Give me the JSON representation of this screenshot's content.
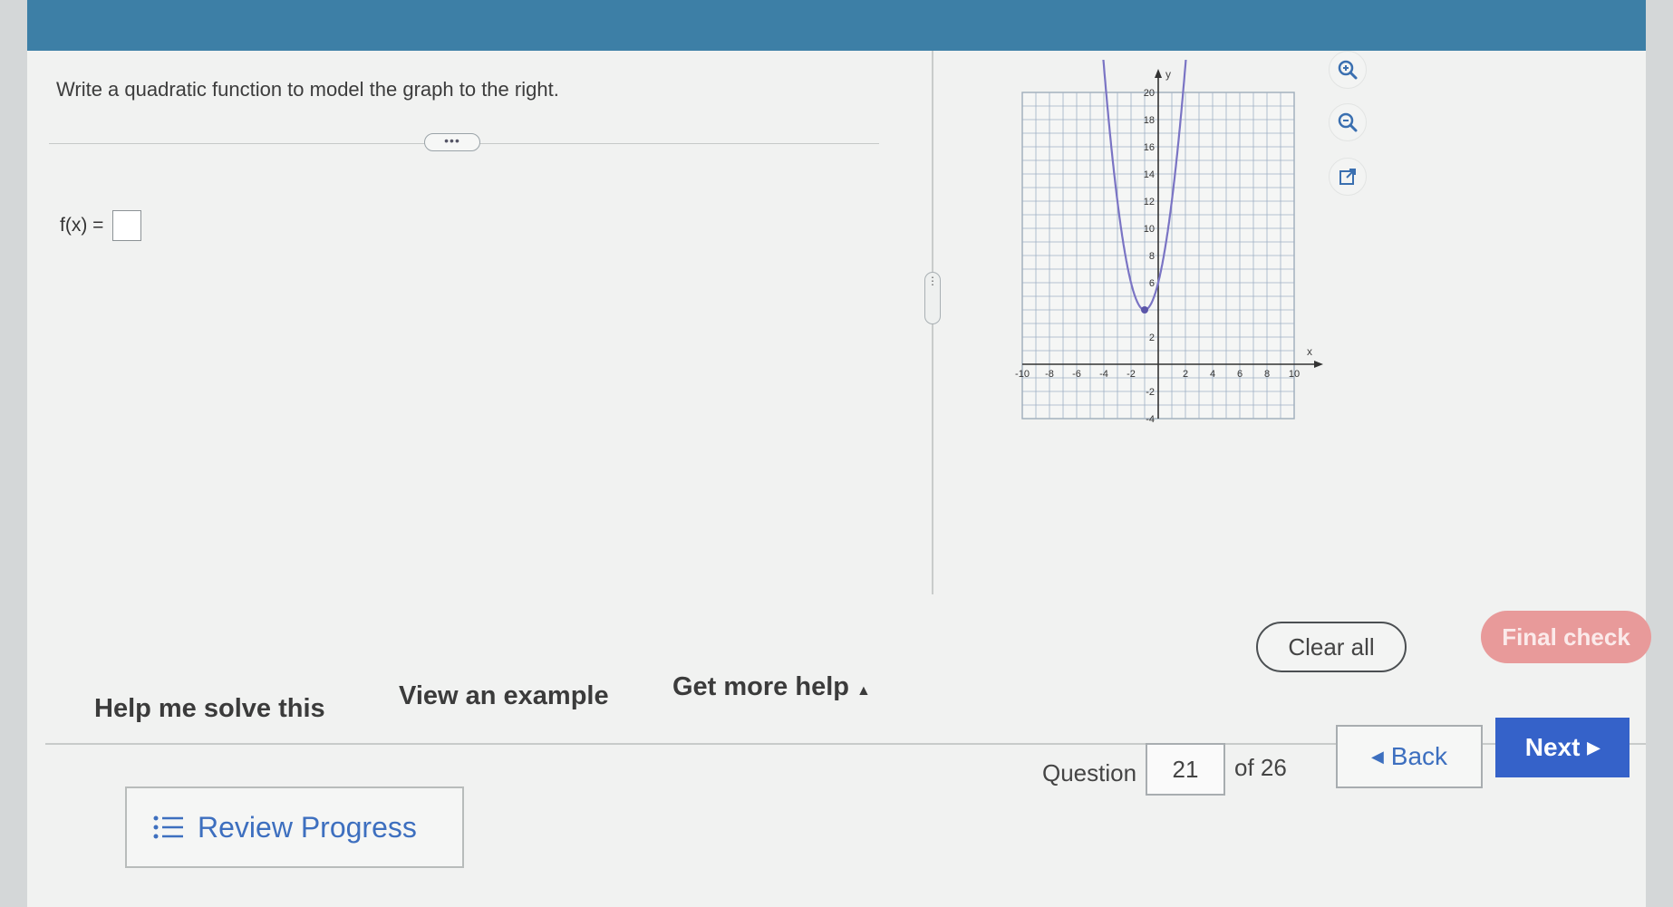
{
  "question": {
    "prompt": "Write a quadratic function to model the graph to the right.",
    "expand_label": "•••",
    "answer_label": "f(x) ="
  },
  "splitter_label": "⋮",
  "graph": {
    "x_axis_label": "x",
    "y_axis_label": "y",
    "x_tick_labels": [
      "-10",
      "-8",
      "-6",
      "-4",
      "-2",
      "2",
      "4",
      "6",
      "8",
      "10"
    ],
    "y_tick_labels": [
      "20",
      "18",
      "16",
      "14",
      "12",
      "10",
      "8",
      "6",
      "2",
      "-2",
      "-4"
    ],
    "tools": [
      "zoom-in-icon",
      "zoom-out-icon",
      "popout-icon"
    ]
  },
  "chart_data": {
    "type": "line",
    "xlim": [
      -10,
      10
    ],
    "ylim": [
      -4,
      20
    ],
    "vertex": [
      -1,
      4
    ],
    "curve": {
      "x": [
        -4.4,
        -3,
        -2,
        -1,
        0,
        1,
        2.4
      ],
      "y": [
        19.6,
        12,
        6,
        4,
        6,
        12,
        19.6
      ]
    },
    "grid": true,
    "colors": {
      "curve": "#7a74c4",
      "vertex": "#5a55a8"
    }
  },
  "actions": {
    "help_solve": "Help me solve this",
    "view_example": "View an example",
    "more_help": "Get more help",
    "more_help_caret": "▲",
    "clear_all": "Clear all",
    "final_check": "Final check"
  },
  "footer": {
    "review_progress": "Review Progress",
    "question_label": "Question",
    "question_number": "21",
    "question_total": "of 26",
    "back_label": "Back",
    "next_label": "Next",
    "back_arrow": "◀",
    "next_arrow": "▶"
  },
  "colors": {
    "topbar": "#3d7fa6",
    "next_button": "#3562c9",
    "final_check": "#e89a9a",
    "link_blue": "#3d6fbf"
  }
}
